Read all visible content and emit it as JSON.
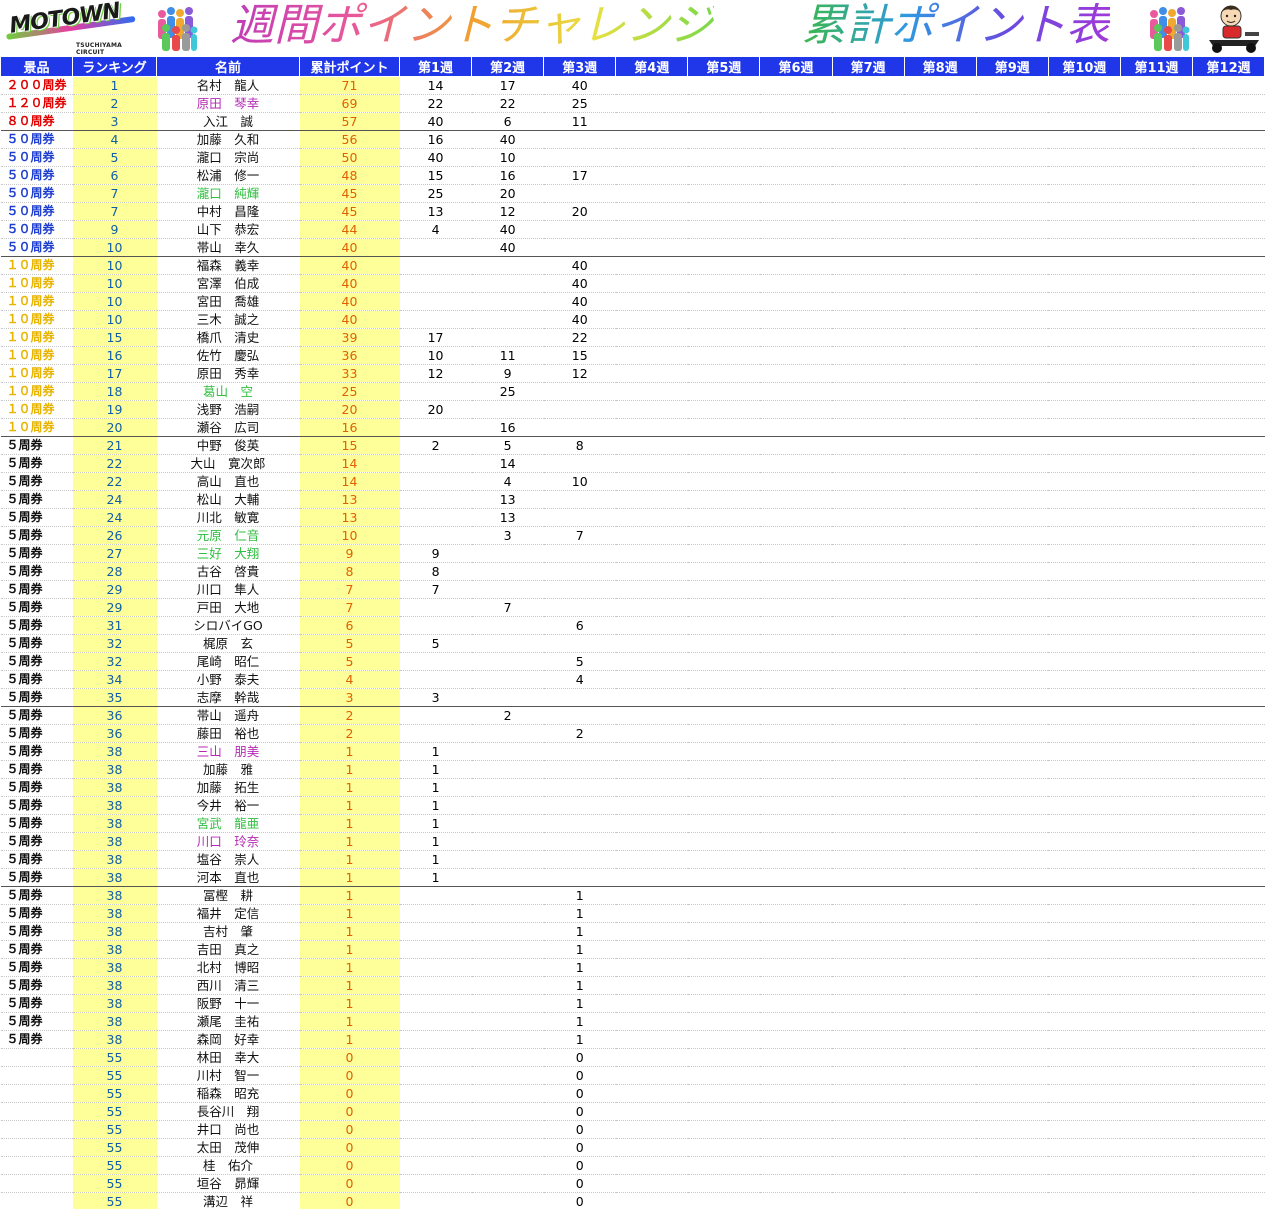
{
  "title": {
    "part1": "週間ポイントチャレンジ",
    "part2": "累計ポイント表"
  },
  "logo": {
    "text": "MOTOWN",
    "sub": "TSUCHIYAMA CIRCUIT"
  },
  "colors": {
    "header_bg": "#1f37e8",
    "highlight_bg": "#ffff99",
    "prize_200": "#e00000",
    "prize_120": "#e00000",
    "prize_80": "#e00000",
    "prize_50": "#1f3fd0",
    "prize_10": "#e8b400",
    "prize_5": "#111111",
    "name_purple": "#b52ab5",
    "name_green": "#2fbf3f"
  },
  "headers": [
    "景品",
    "ランキング",
    "名前",
    "累計ポイント",
    "第1週",
    "第2週",
    "第3週",
    "第4週",
    "第5週",
    "第6週",
    "第7週",
    "第8週",
    "第9週",
    "第10週",
    "第11週",
    "第12週"
  ],
  "rows": [
    {
      "prize": "２００周券",
      "prize_color": "prize_200",
      "rank": "1",
      "name": "名村　龍人",
      "total": "71",
      "w1": "14",
      "w2": "17",
      "w3": "40"
    },
    {
      "prize": "１２０周券",
      "prize_color": "prize_120",
      "rank": "2",
      "name": "原田　琴幸",
      "name_color": "name_purple",
      "total": "69",
      "w1": "22",
      "w2": "22",
      "w3": "25"
    },
    {
      "prize": "８０周券",
      "prize_color": "prize_80",
      "rank": "3",
      "name": "入江　誠",
      "total": "57",
      "w1": "40",
      "w2": "6",
      "w3": "11",
      "group_end": true
    },
    {
      "prize": "５０周券",
      "prize_color": "prize_50",
      "rank": "4",
      "name": "加藤　久和",
      "total": "56",
      "w1": "16",
      "w2": "40",
      "w3": ""
    },
    {
      "prize": "５０周券",
      "prize_color": "prize_50",
      "rank": "5",
      "name": "瀧口　宗尚",
      "total": "50",
      "w1": "40",
      "w2": "10",
      "w3": ""
    },
    {
      "prize": "５０周券",
      "prize_color": "prize_50",
      "rank": "6",
      "name": "松浦　修一",
      "total": "48",
      "w1": "15",
      "w2": "16",
      "w3": "17"
    },
    {
      "prize": "５０周券",
      "prize_color": "prize_50",
      "rank": "7",
      "name": "瀧口　純輝",
      "name_color": "name_green",
      "total": "45",
      "w1": "25",
      "w2": "20",
      "w3": ""
    },
    {
      "prize": "５０周券",
      "prize_color": "prize_50",
      "rank": "7",
      "name": "中村　昌隆",
      "total": "45",
      "w1": "13",
      "w2": "12",
      "w3": "20"
    },
    {
      "prize": "５０周券",
      "prize_color": "prize_50",
      "rank": "9",
      "name": "山下　恭宏",
      "total": "44",
      "w1": "4",
      "w2": "40",
      "w3": ""
    },
    {
      "prize": "５０周券",
      "prize_color": "prize_50",
      "rank": "10",
      "name": "帯山　幸久",
      "total": "40",
      "w1": "",
      "w2": "40",
      "w3": "",
      "group_end": true
    },
    {
      "prize": "１０周券",
      "prize_color": "prize_10",
      "rank": "10",
      "name": "福森　義幸",
      "total": "40",
      "w1": "",
      "w2": "",
      "w3": "40"
    },
    {
      "prize": "１０周券",
      "prize_color": "prize_10",
      "rank": "10",
      "name": "宮澤　伯成",
      "total": "40",
      "w1": "",
      "w2": "",
      "w3": "40"
    },
    {
      "prize": "１０周券",
      "prize_color": "prize_10",
      "rank": "10",
      "name": "宮田　喬雄",
      "total": "40",
      "w1": "",
      "w2": "",
      "w3": "40"
    },
    {
      "prize": "１０周券",
      "prize_color": "prize_10",
      "rank": "10",
      "name": "三木　誠之",
      "total": "40",
      "w1": "",
      "w2": "",
      "w3": "40"
    },
    {
      "prize": "１０周券",
      "prize_color": "prize_10",
      "rank": "15",
      "name": "橋爪　清史",
      "total": "39",
      "w1": "17",
      "w2": "",
      "w3": "22"
    },
    {
      "prize": "１０周券",
      "prize_color": "prize_10",
      "rank": "16",
      "name": "佐竹　慶弘",
      "total": "36",
      "w1": "10",
      "w2": "11",
      "w3": "15"
    },
    {
      "prize": "１０周券",
      "prize_color": "prize_10",
      "rank": "17",
      "name": "原田　秀幸",
      "total": "33",
      "w1": "12",
      "w2": "9",
      "w3": "12"
    },
    {
      "prize": "１０周券",
      "prize_color": "prize_10",
      "rank": "18",
      "name": "葛山　空",
      "name_color": "name_green",
      "total": "25",
      "w1": "",
      "w2": "25",
      "w3": ""
    },
    {
      "prize": "１０周券",
      "prize_color": "prize_10",
      "rank": "19",
      "name": "浅野　浩嗣",
      "total": "20",
      "w1": "20",
      "w2": "",
      "w3": ""
    },
    {
      "prize": "１０周券",
      "prize_color": "prize_10",
      "rank": "20",
      "name": "瀬谷　広司",
      "total": "16",
      "w1": "",
      "w2": "16",
      "w3": "",
      "group_end": true
    },
    {
      "prize": "５周券",
      "prize_color": "prize_5",
      "rank": "21",
      "name": "中野　俊英",
      "total": "15",
      "w1": "2",
      "w2": "5",
      "w3": "8"
    },
    {
      "prize": "５周券",
      "prize_color": "prize_5",
      "rank": "22",
      "name": "大山　寛次郎",
      "total": "14",
      "w1": "",
      "w2": "14",
      "w3": ""
    },
    {
      "prize": "５周券",
      "prize_color": "prize_5",
      "rank": "22",
      "name": "高山　直也",
      "total": "14",
      "w1": "",
      "w2": "4",
      "w3": "10"
    },
    {
      "prize": "５周券",
      "prize_color": "prize_5",
      "rank": "24",
      "name": "松山　大輔",
      "total": "13",
      "w1": "",
      "w2": "13",
      "w3": ""
    },
    {
      "prize": "５周券",
      "prize_color": "prize_5",
      "rank": "24",
      "name": "川北　敏寛",
      "total": "13",
      "w1": "",
      "w2": "13",
      "w3": ""
    },
    {
      "prize": "５周券",
      "prize_color": "prize_5",
      "rank": "26",
      "name": "元原　仁音",
      "name_color": "name_green",
      "total": "10",
      "w1": "",
      "w2": "3",
      "w3": "7"
    },
    {
      "prize": "５周券",
      "prize_color": "prize_5",
      "rank": "27",
      "name": "三好　大翔",
      "name_color": "name_green",
      "total": "9",
      "w1": "9",
      "w2": "",
      "w3": ""
    },
    {
      "prize": "５周券",
      "prize_color": "prize_5",
      "rank": "28",
      "name": "古谷　啓貴",
      "total": "8",
      "w1": "8",
      "w2": "",
      "w3": ""
    },
    {
      "prize": "５周券",
      "prize_color": "prize_5",
      "rank": "29",
      "name": "川口　隼人",
      "total": "7",
      "w1": "7",
      "w2": "",
      "w3": ""
    },
    {
      "prize": "５周券",
      "prize_color": "prize_5",
      "rank": "29",
      "name": "戸田　大地",
      "total": "7",
      "w1": "",
      "w2": "7",
      "w3": ""
    },
    {
      "prize": "５周券",
      "prize_color": "prize_5",
      "rank": "31",
      "name": "シロバイGO",
      "total": "6",
      "w1": "",
      "w2": "",
      "w3": "6"
    },
    {
      "prize": "５周券",
      "prize_color": "prize_5",
      "rank": "32",
      "name": "梶原　玄",
      "total": "5",
      "w1": "5",
      "w2": "",
      "w3": ""
    },
    {
      "prize": "５周券",
      "prize_color": "prize_5",
      "rank": "32",
      "name": "尾崎　昭仁",
      "total": "5",
      "w1": "",
      "w2": "",
      "w3": "5"
    },
    {
      "prize": "５周券",
      "prize_color": "prize_5",
      "rank": "34",
      "name": "小野　泰夫",
      "total": "4",
      "w1": "",
      "w2": "",
      "w3": "4"
    },
    {
      "prize": "５周券",
      "prize_color": "prize_5",
      "rank": "35",
      "name": "志摩　幹哉",
      "total": "3",
      "w1": "3",
      "w2": "",
      "w3": "",
      "group_end": true
    },
    {
      "prize": "５周券",
      "prize_color": "prize_5",
      "rank": "36",
      "name": "帯山　遥舟",
      "total": "2",
      "w1": "",
      "w2": "2",
      "w3": ""
    },
    {
      "prize": "５周券",
      "prize_color": "prize_5",
      "rank": "36",
      "name": "藤田　裕也",
      "total": "2",
      "w1": "",
      "w2": "",
      "w3": "2"
    },
    {
      "prize": "５周券",
      "prize_color": "prize_5",
      "rank": "38",
      "name": "三山　朋美",
      "name_color": "name_purple",
      "total": "1",
      "w1": "1",
      "w2": "",
      "w3": ""
    },
    {
      "prize": "５周券",
      "prize_color": "prize_5",
      "rank": "38",
      "name": "加藤　雅",
      "total": "1",
      "w1": "1",
      "w2": "",
      "w3": ""
    },
    {
      "prize": "５周券",
      "prize_color": "prize_5",
      "rank": "38",
      "name": "加藤　拓生",
      "total": "1",
      "w1": "1",
      "w2": "",
      "w3": ""
    },
    {
      "prize": "５周券",
      "prize_color": "prize_5",
      "rank": "38",
      "name": "今井　裕一",
      "total": "1",
      "w1": "1",
      "w2": "",
      "w3": ""
    },
    {
      "prize": "５周券",
      "prize_color": "prize_5",
      "rank": "38",
      "name": "宮武　龍亜",
      "name_color": "name_green",
      "total": "1",
      "w1": "1",
      "w2": "",
      "w3": ""
    },
    {
      "prize": "５周券",
      "prize_color": "prize_5",
      "rank": "38",
      "name": "川口　玲奈",
      "name_color": "name_purple",
      "total": "1",
      "w1": "1",
      "w2": "",
      "w3": ""
    },
    {
      "prize": "５周券",
      "prize_color": "prize_5",
      "rank": "38",
      "name": "塩谷　崇人",
      "total": "1",
      "w1": "1",
      "w2": "",
      "w3": ""
    },
    {
      "prize": "５周券",
      "prize_color": "prize_5",
      "rank": "38",
      "name": "河本　直也",
      "total": "1",
      "w1": "1",
      "w2": "",
      "w3": "",
      "group_end": true
    },
    {
      "prize": "５周券",
      "prize_color": "prize_5",
      "rank": "38",
      "name": "冨樫　耕",
      "total": "1",
      "w1": "",
      "w2": "",
      "w3": "1"
    },
    {
      "prize": "５周券",
      "prize_color": "prize_5",
      "rank": "38",
      "name": "福井　定信",
      "total": "1",
      "w1": "",
      "w2": "",
      "w3": "1"
    },
    {
      "prize": "５周券",
      "prize_color": "prize_5",
      "rank": "38",
      "name": "吉村　肇",
      "total": "1",
      "w1": "",
      "w2": "",
      "w3": "1"
    },
    {
      "prize": "５周券",
      "prize_color": "prize_5",
      "rank": "38",
      "name": "吉田　真之",
      "total": "1",
      "w1": "",
      "w2": "",
      "w3": "1"
    },
    {
      "prize": "５周券",
      "prize_color": "prize_5",
      "rank": "38",
      "name": "北村　博昭",
      "total": "1",
      "w1": "",
      "w2": "",
      "w3": "1"
    },
    {
      "prize": "５周券",
      "prize_color": "prize_5",
      "rank": "38",
      "name": "西川　清三",
      "total": "1",
      "w1": "",
      "w2": "",
      "w3": "1"
    },
    {
      "prize": "５周券",
      "prize_color": "prize_5",
      "rank": "38",
      "name": "阪野　十一",
      "total": "1",
      "w1": "",
      "w2": "",
      "w3": "1"
    },
    {
      "prize": "５周券",
      "prize_color": "prize_5",
      "rank": "38",
      "name": "瀬尾　圭祐",
      "total": "1",
      "w1": "",
      "w2": "",
      "w3": "1"
    },
    {
      "prize": "５周券",
      "prize_color": "prize_5",
      "rank": "38",
      "name": "森岡　好幸",
      "total": "1",
      "w1": "",
      "w2": "",
      "w3": "1"
    },
    {
      "prize": "",
      "prize_color": "prize_5",
      "rank": "55",
      "name": "林田　幸大",
      "total": "0",
      "w1": "",
      "w2": "",
      "w3": "0"
    },
    {
      "prize": "",
      "prize_color": "prize_5",
      "rank": "55",
      "name": "川村　智一",
      "total": "0",
      "w1": "",
      "w2": "",
      "w3": "0"
    },
    {
      "prize": "",
      "prize_color": "prize_5",
      "rank": "55",
      "name": "稲森　昭充",
      "total": "0",
      "w1": "",
      "w2": "",
      "w3": "0"
    },
    {
      "prize": "",
      "prize_color": "prize_5",
      "rank": "55",
      "name": "長谷川　翔",
      "total": "0",
      "w1": "",
      "w2": "",
      "w3": "0"
    },
    {
      "prize": "",
      "prize_color": "prize_5",
      "rank": "55",
      "name": "井口　尚也",
      "total": "0",
      "w1": "",
      "w2": "",
      "w3": "0"
    },
    {
      "prize": "",
      "prize_color": "prize_5",
      "rank": "55",
      "name": "太田　茂伸",
      "total": "0",
      "w1": "",
      "w2": "",
      "w3": "0"
    },
    {
      "prize": "",
      "prize_color": "prize_5",
      "rank": "55",
      "name": "桂　佑介",
      "total": "0",
      "w1": "",
      "w2": "",
      "w3": "0"
    },
    {
      "prize": "",
      "prize_color": "prize_5",
      "rank": "55",
      "name": "垣谷　昴輝",
      "total": "0",
      "w1": "",
      "w2": "",
      "w3": "0"
    },
    {
      "prize": "",
      "prize_color": "prize_5",
      "rank": "55",
      "name": "溝辺　祥",
      "total": "0",
      "w1": "",
      "w2": "",
      "w3": "0"
    }
  ]
}
